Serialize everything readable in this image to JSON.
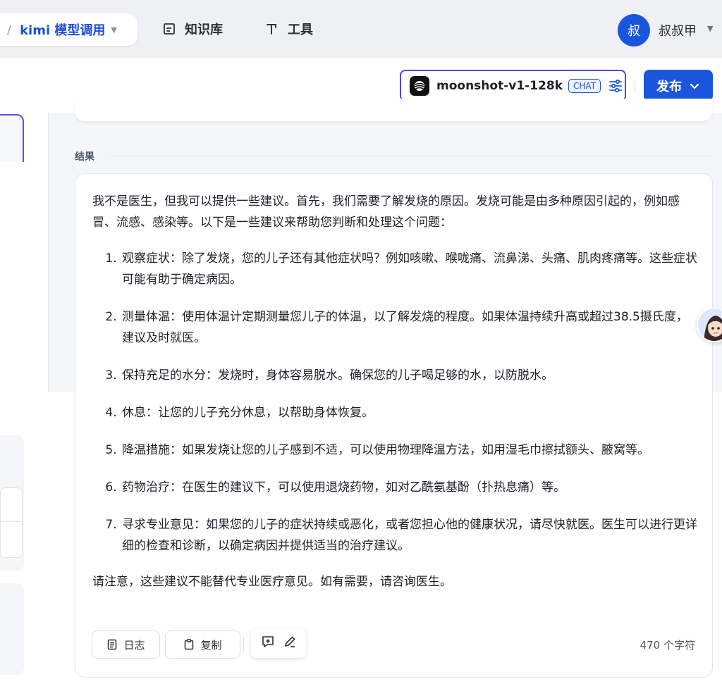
{
  "nav": {
    "breadcrumb_sep": "/",
    "app_name": "kimi 模型调用",
    "knowledge_label": "知识库",
    "tools_label": "工具",
    "user_avatar_char": "叔",
    "user_name": "叔叔甲"
  },
  "toolbar": {
    "model_name": "moonshot-v1-128k",
    "model_badge": "CHAT",
    "publish_label": "发布"
  },
  "result": {
    "section_label": "结果",
    "intro": "我不是医生，但我可以提供一些建议。首先，我们需要了解发烧的原因。发烧可能是由多种原因引起的，例如感冒、流感、感染等。以下是一些建议来帮助您判断和处理这个问题：",
    "items": [
      "观察症状：除了发烧，您的儿子还有其他症状吗？例如咳嗽、喉咙痛、流鼻涕、头痛、肌肉疼痛等。这些症状可能有助于确定病因。",
      "测量体温：使用体温计定期测量您儿子的体温，以了解发烧的程度。如果体温持续升高或超过38.5摄氏度，建议及时就医。",
      "保持充足的水分：发烧时，身体容易脱水。确保您的儿子喝足够的水，以防脱水。",
      "休息：让您的儿子充分休息，以帮助身体恢复。",
      "降温措施：如果发烧让您的儿子感到不适，可以使用物理降温方法，如用湿毛巾擦拭额头、腋窝等。",
      "药物治疗：在医生的建议下，可以使用退烧药物，如对乙酰氨基酚（扑热息痛）等。",
      "寻求专业意见：如果您的儿子的症状持续或恶化，或者您担心他的健康状况，请尽快就医。医生可以进行更详细的检查和诊断，以确定病因并提供适当的治疗建议。"
    ],
    "outro": "请注意，这些建议不能替代专业医疗意见。如有需要，请咨询医生。",
    "log_label": "日志",
    "copy_label": "复制",
    "char_count": "470 个字符"
  },
  "colors": {
    "accent": "#1a56db",
    "panel_border": "#5b4fe0"
  },
  "icons": [
    "chevron-down-icon",
    "book-icon",
    "tool-icon",
    "moonshot-logo-icon",
    "settings-sliders-icon",
    "document-icon",
    "clipboard-icon",
    "sparkle-chat-icon",
    "edit-pen-icon"
  ]
}
